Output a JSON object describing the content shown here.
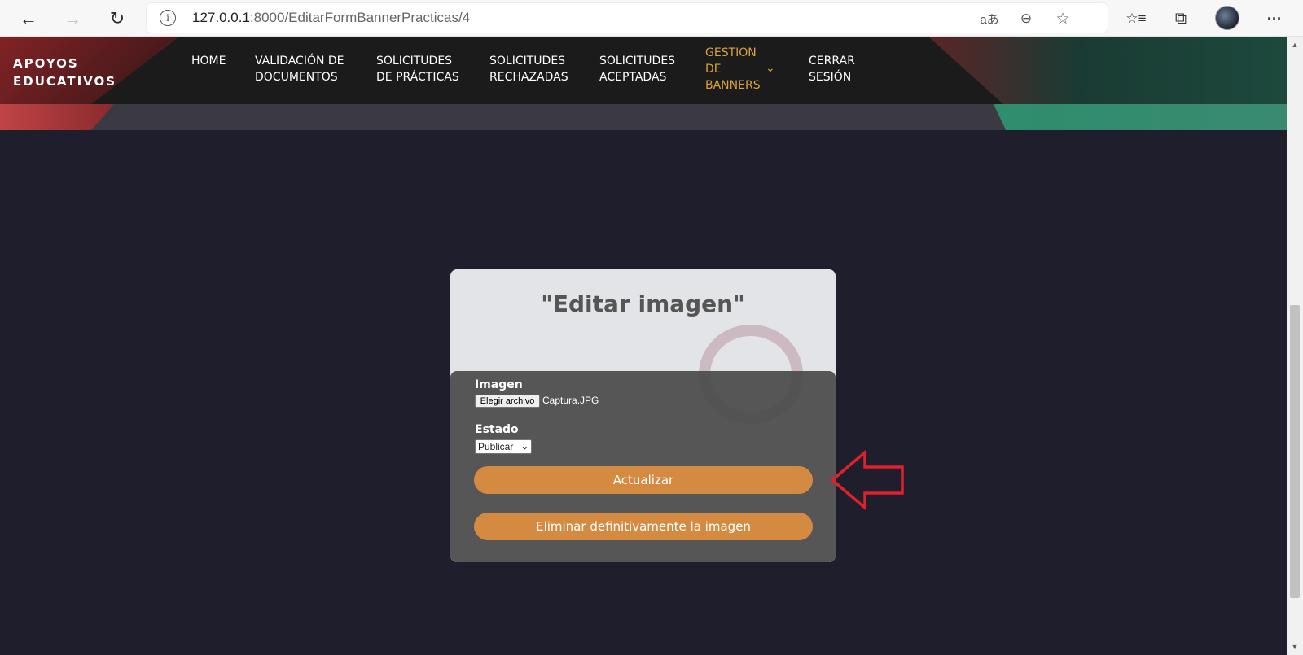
{
  "browser": {
    "url_host": "127.0.0.1",
    "url_path": ":8000/EditarFormBannerPracticas/4",
    "info_glyph": "i",
    "icons": {
      "back": "arrow-left-icon",
      "forward": "arrow-right-icon",
      "refresh": "refresh-icon",
      "read_aloud": "read-aloud-icon",
      "zoom": "zoom-out-icon",
      "favorite": "add-favorite-icon",
      "favorites": "favorites-icon",
      "collections": "collections-icon",
      "more": "more-icon"
    },
    "glyphs": {
      "back": "←",
      "forward": "→",
      "refresh": "↻",
      "read_aloud": "aあ",
      "zoom": "⊖",
      "favorite": "☆",
      "favorites": "☆≡",
      "collections": "⧉",
      "more": "···"
    }
  },
  "header": {
    "brand_line1": "APOYOS",
    "brand_line2": "EDUCATIVOS",
    "menu": [
      {
        "line1": "HOME",
        "line2": ""
      },
      {
        "line1": "VALIDACIÓN DE",
        "line2": "DOCUMENTOS"
      },
      {
        "line1": "SOLICITUDES",
        "line2": "DE PRÁCTICAS"
      },
      {
        "line1": "SOLICITUDES",
        "line2": "RECHAZADAS"
      },
      {
        "line1": "SOLICITUDES",
        "line2": "ACEPTADAS"
      },
      {
        "line1": "GESTION",
        "line2": "DE",
        "line3": "BANNERS"
      },
      {
        "line1": "CERRAR",
        "line2": "SESIÓN"
      }
    ],
    "dropdown_glyph": "⌄",
    "colors": {
      "active": "#d9a23d",
      "bg": "#1b1b1b"
    }
  },
  "card": {
    "title": "\"Editar imagen\"",
    "image_label": "Imagen",
    "file_button": "Elegir archivo",
    "file_name": "Captura.JPG",
    "estado_label": "Estado",
    "estado_value": "Publicar",
    "update_button": "Actualizar",
    "delete_button": "Eliminar definitivamente la imagen",
    "colors": {
      "button": "#d58a42",
      "panel": "#4a4a4a",
      "card": "#e3e4e8"
    }
  },
  "annotation": {
    "arrow_color": "#e0202a",
    "icon": "red-arrow-left-icon"
  },
  "page": {
    "background": "#1f1e2c"
  }
}
